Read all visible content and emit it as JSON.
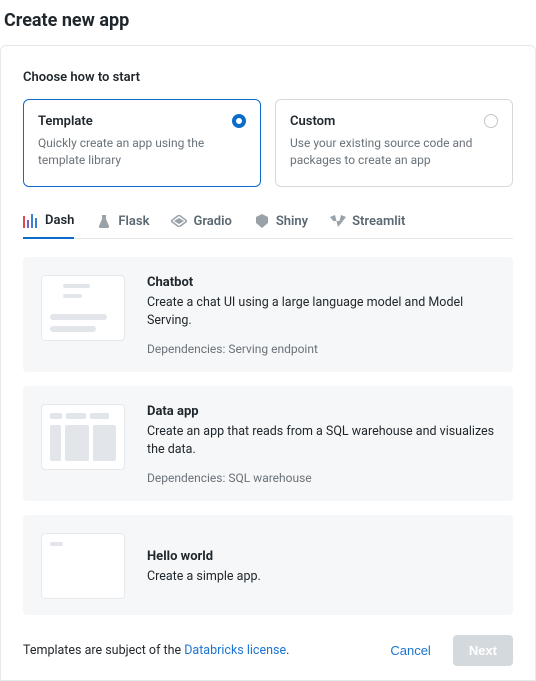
{
  "page_title": "Create new app",
  "section_label": "Choose how to start",
  "start_options": [
    {
      "title": "Template",
      "desc": "Quickly create an app using the template library",
      "selected": true
    },
    {
      "title": "Custom",
      "desc": "Use your existing source code and packages to create an app",
      "selected": false
    }
  ],
  "tabs": [
    {
      "label": "Dash",
      "icon": "dash-icon",
      "active": true
    },
    {
      "label": "Flask",
      "icon": "flask-icon",
      "active": false
    },
    {
      "label": "Gradio",
      "icon": "gradio-icon",
      "active": false
    },
    {
      "label": "Shiny",
      "icon": "shiny-icon",
      "active": false
    },
    {
      "label": "Streamlit",
      "icon": "streamlit-icon",
      "active": false
    }
  ],
  "templates": [
    {
      "title": "Chatbot",
      "desc": "Create a chat UI using a large language model and Model Serving.",
      "deps": "Dependencies: Serving endpoint"
    },
    {
      "title": "Data app",
      "desc": "Create an app that reads from a SQL warehouse and visualizes the data.",
      "deps": "Dependencies: SQL warehouse"
    },
    {
      "title": "Hello world",
      "desc": "Create a simple app.",
      "deps": ""
    }
  ],
  "footer": {
    "prefix": "Templates are subject of the ",
    "link_text": "Databricks license",
    "suffix": ".",
    "cancel": "Cancel",
    "next": "Next"
  }
}
